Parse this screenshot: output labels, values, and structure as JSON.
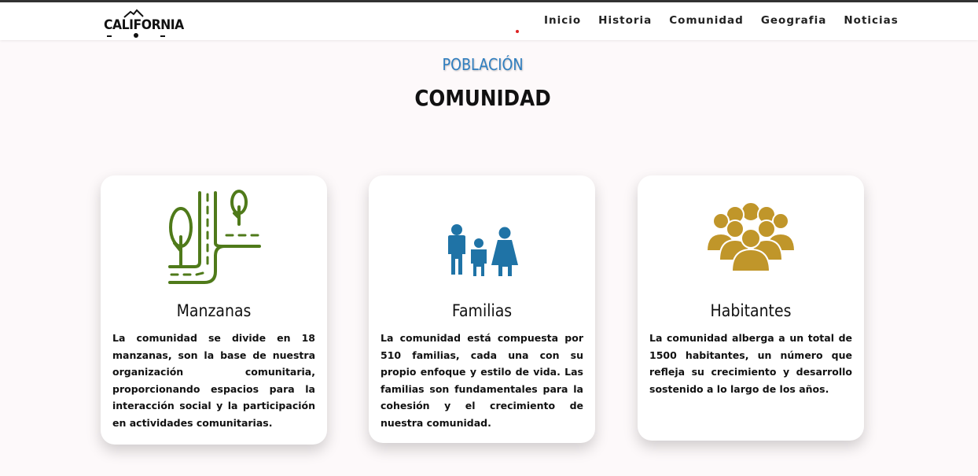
{
  "header": {
    "logo_text": "CALIFORNIA",
    "nav": [
      "Inicio",
      "Historia",
      "Comunidad",
      "Geografia",
      "Noticias"
    ]
  },
  "section": {
    "eyebrow": "POBLACIÓN",
    "title": "COMUNIDAD"
  },
  "cards": [
    {
      "title": "Manzanas",
      "text": "La comunidad se divide en 18 manzanas, son la base de nuestra organización comunitaria, proporcionando espacios para la interacción social y la participación en actividades comunitarias.",
      "icon": "road-trees-icon",
      "color": "#4f7a1a"
    },
    {
      "title": "Familias",
      "text": "La comunidad está compuesta por 510 familias, cada una con su propio enfoque y estilo de vida. Las familias son fundamentales para la cohesión y el crecimiento de nuestra comunidad.",
      "icon": "family-icon",
      "color": "#1f73a6"
    },
    {
      "title": "Habitantes",
      "text": "La comunidad alberga a un total de 1500 habitantes, un número que refleja su crecimiento y desarrollo sostenido a lo largo de los años.",
      "icon": "crowd-icon",
      "color": "#c0962a"
    }
  ]
}
